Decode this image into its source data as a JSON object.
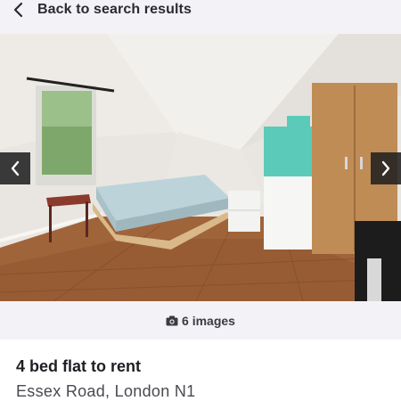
{
  "header": {
    "back_label": "Back to search results",
    "back_icon": "chevron-left-icon"
  },
  "gallery": {
    "prev_icon": "chevron-left-icon",
    "next_icon": "chevron-right-icon",
    "image_count_label": "6 images",
    "camera_icon": "camera-icon",
    "overlay_color": "#212121"
  },
  "listing": {
    "title": "4 bed flat to rent",
    "address": "Essex Road, London N1"
  },
  "colors": {
    "topbar_bg": "#f3f2f7",
    "title_text": "#1f1e24",
    "address_text": "#4a4950"
  }
}
